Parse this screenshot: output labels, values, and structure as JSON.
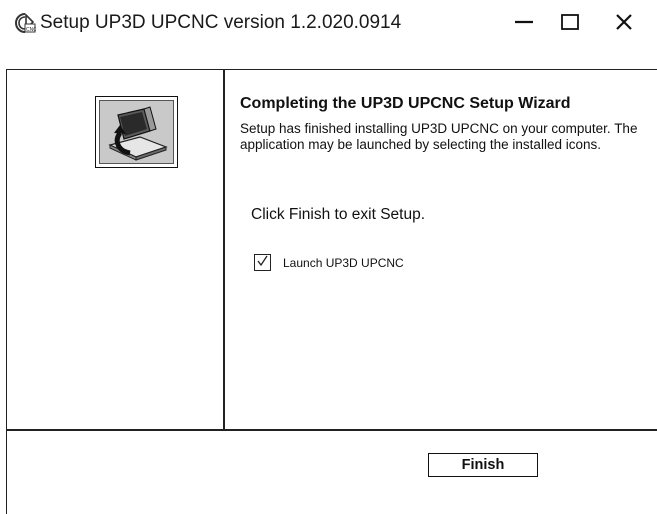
{
  "window": {
    "title": "Setup UP3D UPCNC version 1.2.020.0914",
    "controls": {
      "minimize": "minimize-icon",
      "maximize": "maximize-icon",
      "close": "close-icon"
    },
    "app_icon": "upcnc-app-icon"
  },
  "banner": {
    "icon": "installer-computer-icon"
  },
  "content": {
    "heading": "Completing  the UP3D UPCNC Setup Wizard",
    "description": "Setup has finished installing UP3D UPCNC on your computer. The application may be launched by selecting the installed icons.",
    "click_finish": "Click Finish to exit Setup.",
    "launch_checkbox": {
      "label": "Launch UP3D UPCNC",
      "checked": true
    }
  },
  "footer": {
    "finish_label": "Finish"
  },
  "colors": {
    "background": "#ffffff",
    "border": "#222222",
    "banner_fill": "#c9c9c9"
  }
}
